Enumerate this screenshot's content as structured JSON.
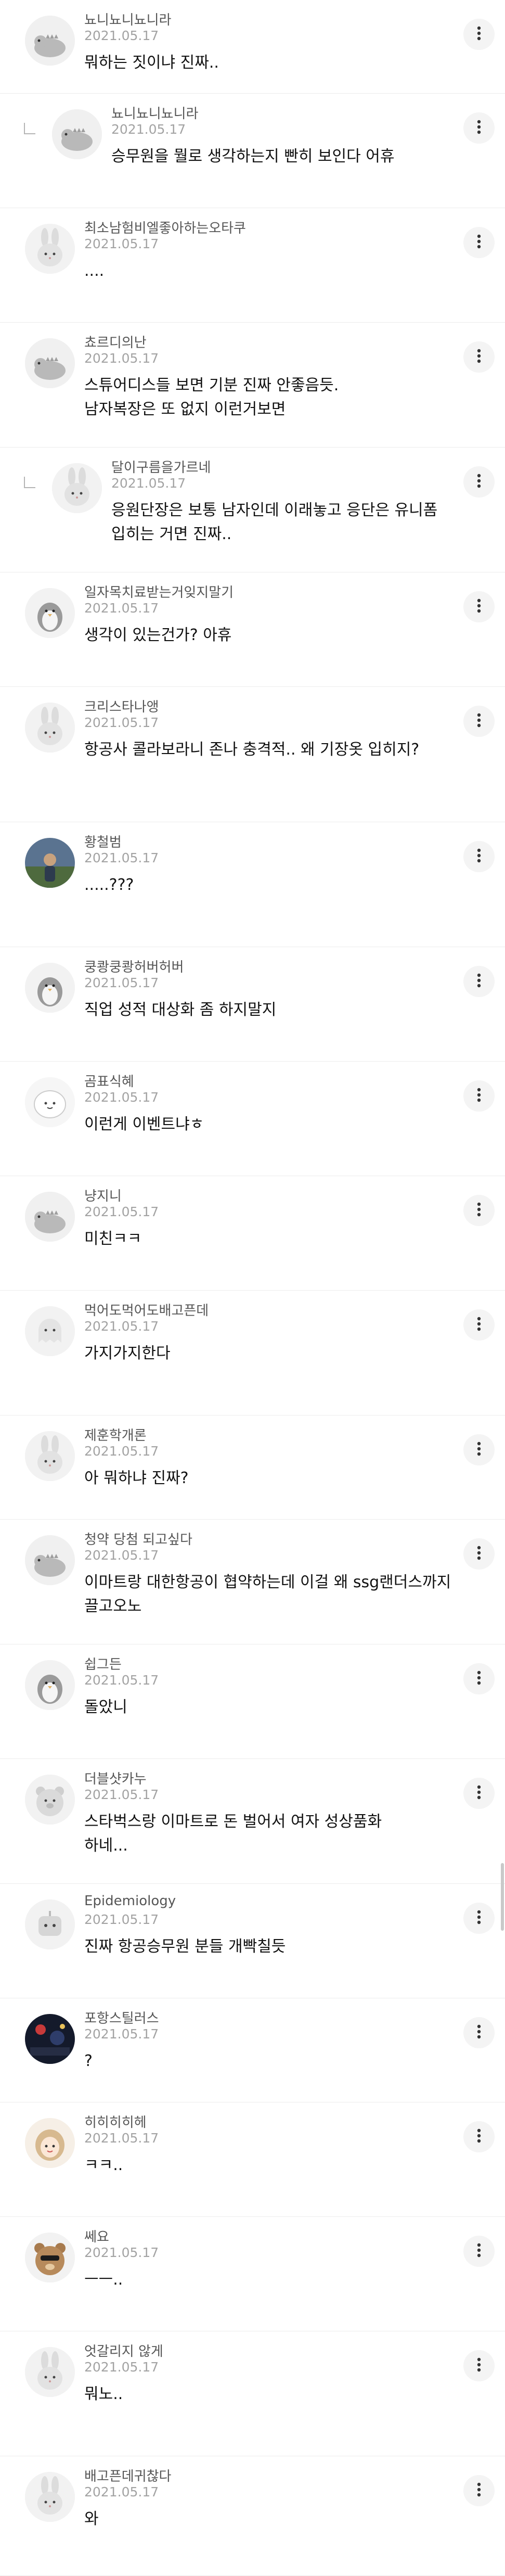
{
  "more_label": "⋮",
  "comments": [
    {
      "nickname": "뇨니뇨니뇨니라",
      "date": "2021.05.17",
      "lines": [
        "뭐하는 짓이냐 진짜.."
      ],
      "avatar": "dino-avatar",
      "reply": false
    },
    {
      "nickname": "뇨니뇨니뇨니라",
      "date": "2021.05.17",
      "lines": [
        "승무원을 뭘로 생각하는지 빤히 보인다 어휴"
      ],
      "avatar": "dino-avatar",
      "reply": true
    },
    {
      "nickname": "최소남험비엘좋아하는오타쿠",
      "date": "2021.05.17",
      "lines": [
        "...."
      ],
      "avatar": "bunny-avatar",
      "reply": false
    },
    {
      "nickname": "쵸르디의난",
      "date": "2021.05.17",
      "lines": [
        "스튜어디스들 보면 기분 진짜 안좋음듯.",
        "남자복장은 또 없지 이런거보면"
      ],
      "avatar": "dino-avatar",
      "reply": false
    },
    {
      "nickname": "달이구름을가르네",
      "date": "2021.05.17",
      "lines": [
        "응원단장은 보통 남자인데 이래놓고 응단은 유니폼",
        "입히는 거면 진짜.."
      ],
      "avatar": "bunny-avatar",
      "reply": true
    },
    {
      "nickname": "일자목치료받는거잊지말기",
      "date": "2021.05.17",
      "lines": [
        "생각이 있는건가? 아휴"
      ],
      "avatar": "penguin-avatar",
      "reply": false
    },
    {
      "nickname": "크리스타나앵",
      "date": "2021.05.17",
      "lines": [
        "항공사 콜라보라니 존나 충격적.. 왜 기장옷 입히지?"
      ],
      "avatar": "bunny-avatar",
      "reply": false
    },
    {
      "nickname": "황철범",
      "date": "2021.05.17",
      "lines": [
        ".....???"
      ],
      "avatar": "photo-avatar",
      "reply": false
    },
    {
      "nickname": "쿵쾅쿵쾅허버허버",
      "date": "2021.05.17",
      "lines": [
        "직업 성적 대상화 좀 하지말지"
      ],
      "avatar": "penguin-avatar",
      "reply": false
    },
    {
      "nickname": "곰표식혜",
      "date": "2021.05.17",
      "lines": [
        "이런게 이벤트냐ㅎ"
      ],
      "avatar": "blob-avatar",
      "reply": false
    },
    {
      "nickname": "냥지니",
      "date": "2021.05.17",
      "lines": [
        "미친ㅋㅋ"
      ],
      "avatar": "dino-avatar",
      "reply": false
    },
    {
      "nickname": "먹어도먹어도배고픈데",
      "date": "2021.05.17",
      "lines": [
        "가지가지한다"
      ],
      "avatar": "ghost-avatar",
      "reply": false
    },
    {
      "nickname": "제훈학개론",
      "date": "2021.05.17",
      "lines": [
        "아 뭐하냐 진짜?"
      ],
      "avatar": "bunny-avatar",
      "reply": false
    },
    {
      "nickname": "청약 당첨 되고싶다",
      "date": "2021.05.17",
      "lines": [
        "이마트랑 대한항공이 협약하는데 이걸 왜 ssg랜더스까지",
        "끌고오노"
      ],
      "avatar": "dino-avatar",
      "reply": false
    },
    {
      "nickname": "쉽그든",
      "date": "2021.05.17",
      "lines": [
        "돌았니"
      ],
      "avatar": "penguin-avatar",
      "reply": false
    },
    {
      "nickname": "더블샷카누",
      "date": "2021.05.17",
      "lines": [
        "스타벅스랑 이마트로 돈 벌어서 여자 성상품화",
        "하네..."
      ],
      "avatar": "bear-avatar",
      "reply": false
    },
    {
      "nickname": "Epidemiology",
      "date": "2021.05.17",
      "lines": [
        "진짜 항공승무원 분들 개빡칠듯"
      ],
      "avatar": "robot-avatar",
      "reply": false
    },
    {
      "nickname": "포항스틸러스",
      "date": "2021.05.17",
      "lines": [
        "?"
      ],
      "avatar": "stadium-avatar",
      "reply": false
    },
    {
      "nickname": "히히히히헤",
      "date": "2021.05.17",
      "lines": [
        "ㅋㅋ.."
      ],
      "avatar": "girl-avatar",
      "reply": false
    },
    {
      "nickname": "쎄요",
      "date": "2021.05.17",
      "lines": [
        "ㅡㅡ.."
      ],
      "avatar": "teddy-avatar",
      "reply": false
    },
    {
      "nickname": "엇갈리지 않게",
      "date": "2021.05.17",
      "lines": [
        "뭐노.."
      ],
      "avatar": "bunny-avatar",
      "reply": false
    },
    {
      "nickname": "배고픈데귀찮다",
      "date": "2021.05.17",
      "lines": [
        "와"
      ],
      "avatar": "bunny-avatar",
      "reply": false
    }
  ]
}
